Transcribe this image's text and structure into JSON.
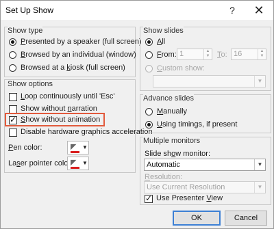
{
  "window": {
    "title": "Set Up Show",
    "help_glyph": "?",
    "close_glyph": "✕"
  },
  "show_type": {
    "label": "Show type",
    "options": [
      {
        "label": "Presented by a speaker (full screen)",
        "selected": true
      },
      {
        "label": "Browsed by an individual (window)",
        "selected": false
      },
      {
        "label": "Browsed at a kiosk (full screen)",
        "selected": false
      }
    ]
  },
  "show_options": {
    "label": "Show options",
    "items": [
      {
        "label": "Loop continuously until 'Esc'",
        "checked": false
      },
      {
        "label": "Show without narration",
        "checked": false
      },
      {
        "label": "Show without animation",
        "checked": true
      },
      {
        "label": "Disable hardware graphics acceleration",
        "checked": false
      }
    ],
    "pen_color_label": "Pen color:",
    "laser_color_label": "Laser pointer color:",
    "pen_color": "#d91e1e",
    "laser_color": "#d91e1e"
  },
  "show_slides": {
    "label": "Show slides",
    "all_label": "All",
    "from_label": "From:",
    "to_label": "To:",
    "from_value": "1",
    "to_value": "16",
    "custom_label": "Custom show:",
    "custom_value": ""
  },
  "advance_slides": {
    "label": "Advance slides",
    "manually_label": "Manually",
    "timings_label": "Using timings, if present"
  },
  "multiple_monitors": {
    "label": "Multiple monitors",
    "monitor_label": "Slide show monitor:",
    "monitor_value": "Automatic",
    "resolution_label": "Resolution:",
    "resolution_value": "Use Current Resolution",
    "presenter_view_label": "Use Presenter View",
    "presenter_view_checked": true
  },
  "buttons": {
    "ok": "OK",
    "cancel": "Cancel"
  },
  "colors": {
    "highlight": "#e25a3c",
    "default_button_border": "#3c7fd4"
  }
}
